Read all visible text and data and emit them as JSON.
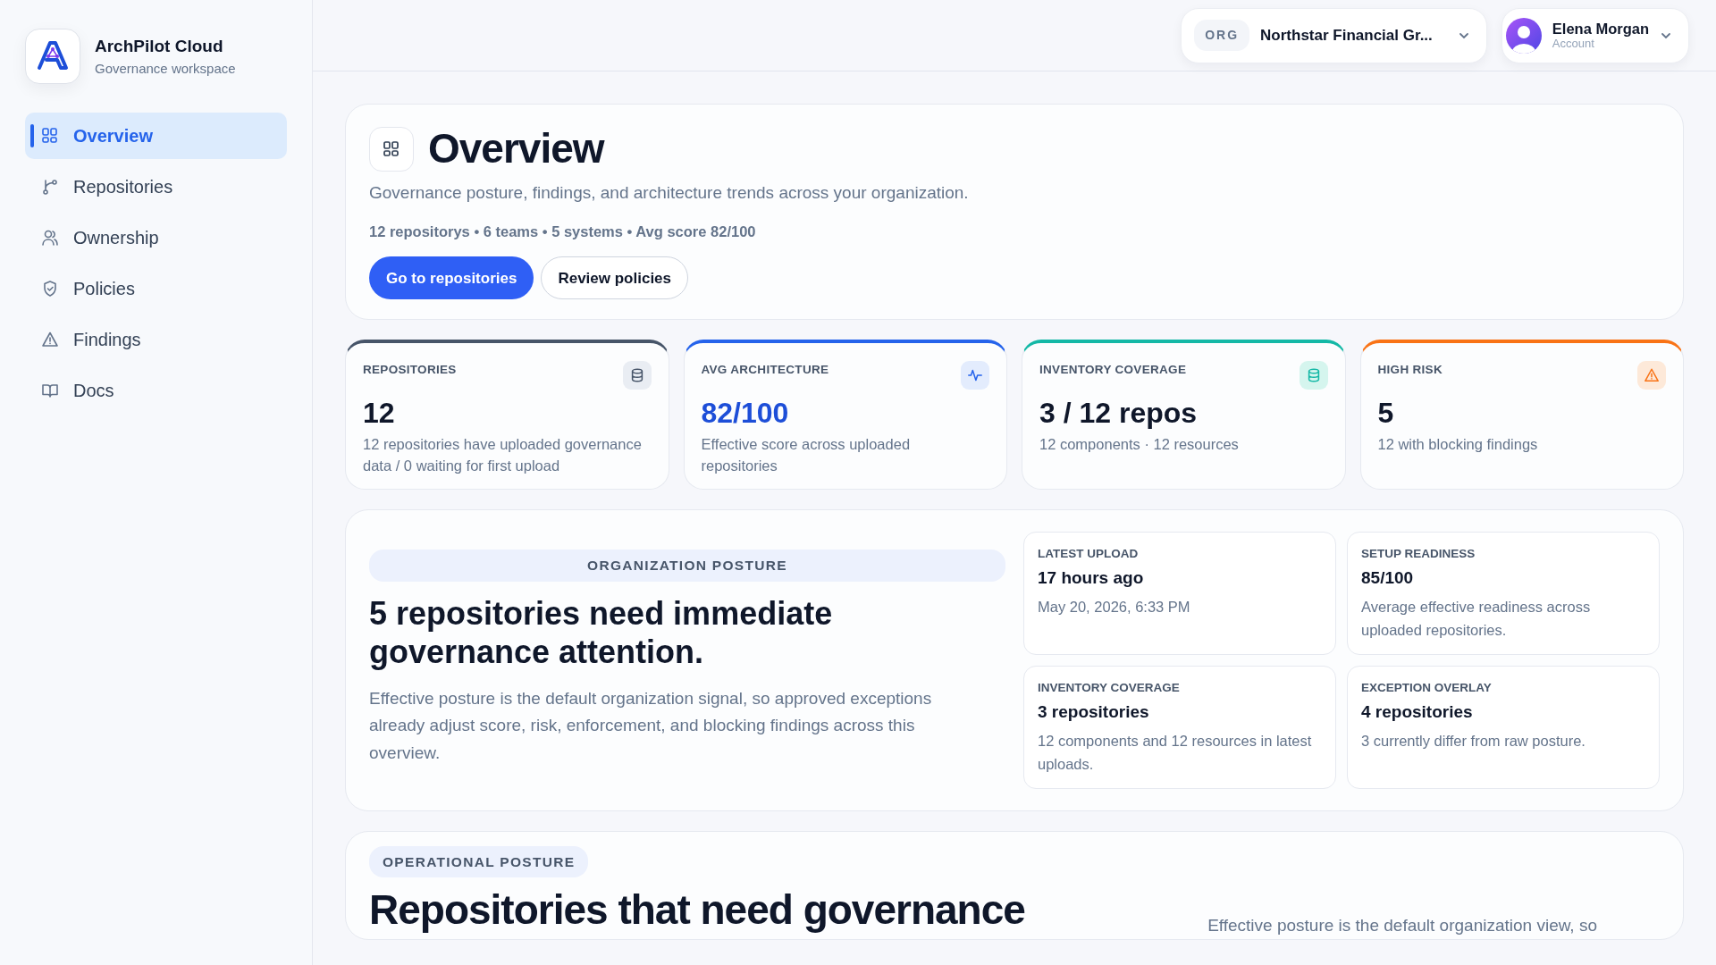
{
  "brand": {
    "name": "ArchPilot Cloud",
    "subtitle": "Governance workspace"
  },
  "sidebar": {
    "items": [
      {
        "label": "Overview",
        "selected": true
      },
      {
        "label": "Repositories",
        "selected": false
      },
      {
        "label": "Ownership",
        "selected": false
      },
      {
        "label": "Policies",
        "selected": false
      },
      {
        "label": "Findings",
        "selected": false
      },
      {
        "label": "Docs",
        "selected": false
      }
    ]
  },
  "topbar": {
    "org": {
      "tag": "ORG",
      "name": "Northstar Financial Gr..."
    },
    "account": {
      "name": "Elena Morgan",
      "role": "Account"
    }
  },
  "header": {
    "title": "Overview",
    "subtitle": "Governance posture, findings, and architecture trends across your organization.",
    "summary": "12 repositorys • 6 teams • 5 systems • Avg score 82/100",
    "actions": [
      {
        "label": "Go to repositories",
        "kind": "primary"
      },
      {
        "label": "Review policies",
        "kind": "secondary"
      }
    ]
  },
  "stats": [
    {
      "kind": "neutral",
      "color": "#475569",
      "label": "REPOSITORIES",
      "value": "12",
      "note": "12 repositories have uploaded governance data / 0 waiting for first upload"
    },
    {
      "kind": "score",
      "color": "#2563eb",
      "label": "AVG ARCHITECTURE",
      "value": "82/100",
      "note": "Effective score across uploaded repositories"
    },
    {
      "kind": "coverage",
      "color": "#14b8a6",
      "label": "INVENTORY COVERAGE",
      "value": "3 / 12 repos",
      "note": "12 components · 12 resources"
    },
    {
      "kind": "risk",
      "color": "#f97316",
      "label": "HIGH RISK",
      "value": "5",
      "note": "12 with blocking findings"
    }
  ],
  "org_posture": {
    "tag": "ORGANIZATION POSTURE",
    "headline": "5 repositories need immediate governance attention.",
    "text": "Effective posture is the default organization signal, so approved exceptions already adjust score, risk, enforcement, and blocking findings across this overview.",
    "tiles": [
      {
        "label": "LATEST UPLOAD",
        "value": "17 hours ago",
        "note": "May 20, 2026, 6:33 PM"
      },
      {
        "label": "SETUP READINESS",
        "value": "85/100",
        "note": "Average effective readiness across uploaded repositories."
      },
      {
        "label": "INVENTORY COVERAGE",
        "value": "3 repositories",
        "note": "12 components and 12 resources in latest uploads."
      },
      {
        "label": "EXCEPTION OVERLAY",
        "value": "4 repositories",
        "note": "3 currently differ from raw posture."
      }
    ]
  },
  "operational_posture": {
    "tag": "OPERATIONAL POSTURE",
    "headline": "Repositories that need governance",
    "text": "Effective posture is the default organization view, so"
  }
}
